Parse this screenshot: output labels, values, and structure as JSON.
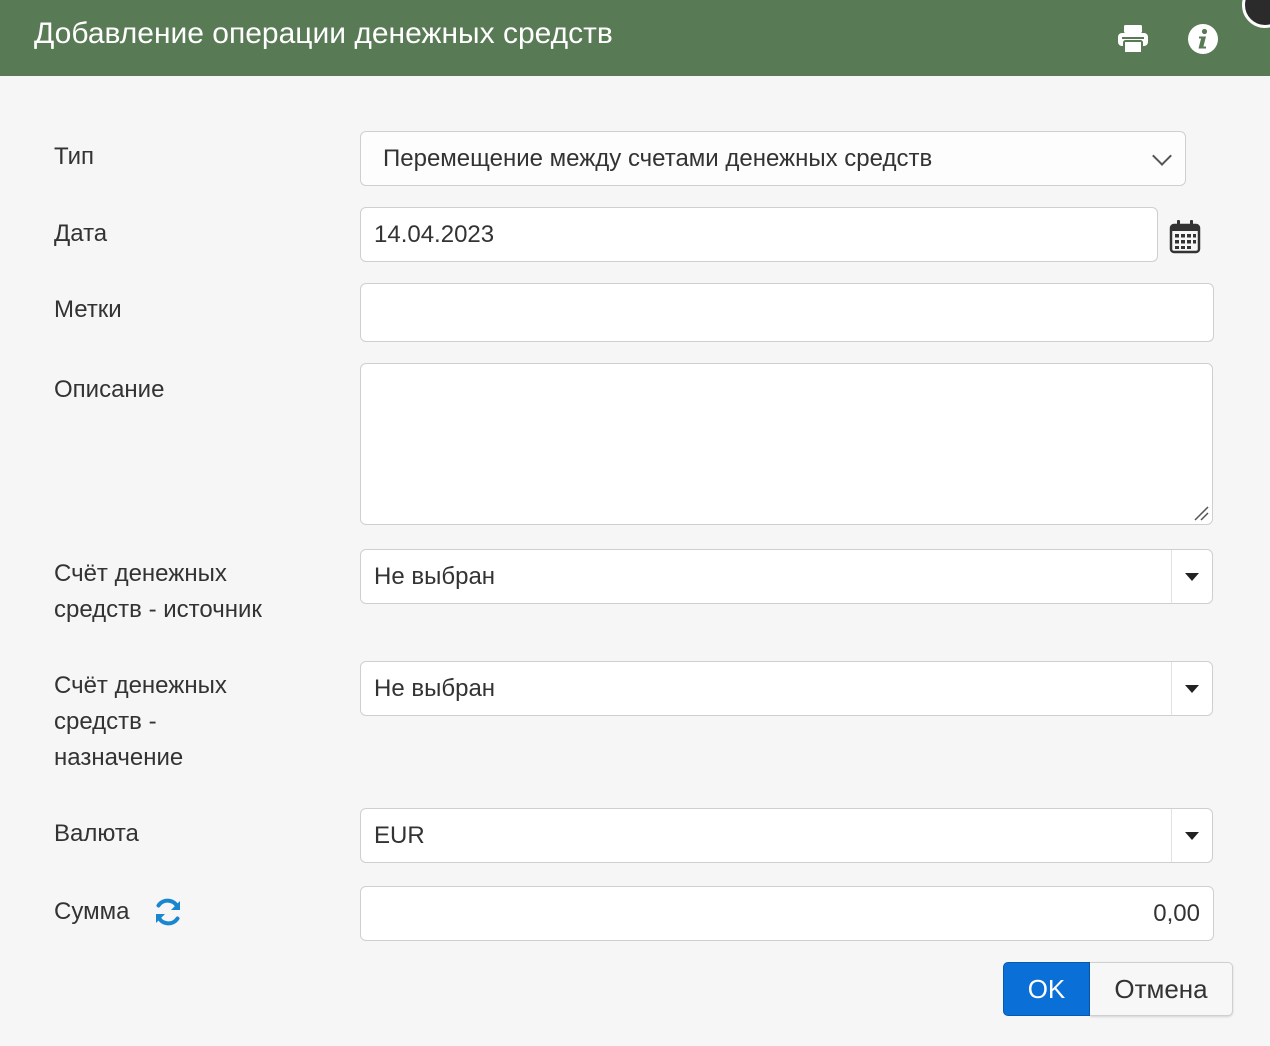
{
  "dialog": {
    "title": "Добавление операции денежных средств",
    "print_icon": "print-icon",
    "info_icon": "info-icon"
  },
  "form": {
    "type": {
      "label": "Тип",
      "value": "Перемещение между счетами денежных средств"
    },
    "date": {
      "label": "Дата",
      "value": "14.04.2023"
    },
    "tags": {
      "label": "Метки",
      "value": ""
    },
    "description": {
      "label": "Описание",
      "value": ""
    },
    "source_account": {
      "label_line1": "Счёт денежных",
      "label_line2": "средств - источник",
      "value": "Не выбран"
    },
    "target_account": {
      "label_line1": "Счёт денежных",
      "label_line2": "средств -",
      "label_line3": "назначение",
      "value": "Не выбран"
    },
    "currency": {
      "label": "Валюта",
      "value": "EUR"
    },
    "amount": {
      "label": "Сумма",
      "value": "0,00"
    }
  },
  "buttons": {
    "ok": "OK",
    "cancel": "Отмена"
  },
  "colors": {
    "header_bg": "#587a54",
    "primary": "#0a6fd6",
    "refresh_icon": "#1a86d0"
  }
}
